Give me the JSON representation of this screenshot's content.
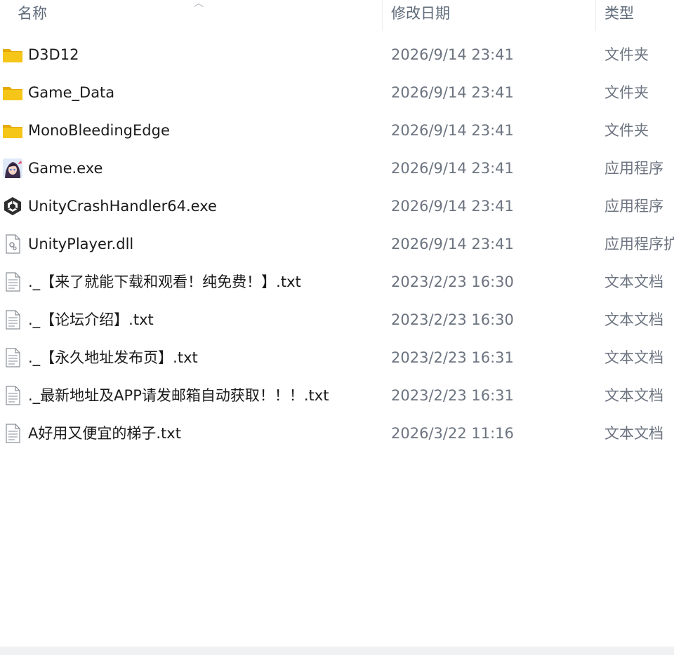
{
  "columns": {
    "name": "名称",
    "modified": "修改日期",
    "type": "类型"
  },
  "files": [
    {
      "name": "D3D12",
      "modified": "2026/9/14 23:41",
      "type": "文件夹",
      "icon": "folder-icon"
    },
    {
      "name": "Game_Data",
      "modified": "2026/9/14 23:41",
      "type": "文件夹",
      "icon": "folder-icon"
    },
    {
      "name": "MonoBleedingEdge",
      "modified": "2026/9/14 23:41",
      "type": "文件夹",
      "icon": "folder-icon"
    },
    {
      "name": "Game.exe",
      "modified": "2026/9/14 23:41",
      "type": "应用程序",
      "icon": "game-app-icon"
    },
    {
      "name": "UnityCrashHandler64.exe",
      "modified": "2026/9/14 23:41",
      "type": "应用程序",
      "icon": "unity-logo-icon"
    },
    {
      "name": "UnityPlayer.dll",
      "modified": "2026/9/14 23:41",
      "type": "应用程序扩",
      "icon": "dll-file-icon"
    },
    {
      "name": "._【来了就能下载和观看！纯免费！】.txt",
      "modified": "2023/2/23 16:30",
      "type": "文本文档",
      "icon": "text-file-icon"
    },
    {
      "name": "._【论坛介绍】.txt",
      "modified": "2023/2/23 16:30",
      "type": "文本文档",
      "icon": "text-file-icon"
    },
    {
      "name": "._【永久地址发布页】.txt",
      "modified": "2023/2/23 16:31",
      "type": "文本文档",
      "icon": "text-file-icon"
    },
    {
      "name": "._最新地址及APP请发邮箱自动获取！！！.txt",
      "modified": "2023/2/23 16:31",
      "type": "文本文档",
      "icon": "text-file-icon"
    },
    {
      "name": "A好用又便宜的梯子.txt",
      "modified": "2026/3/22 11:16",
      "type": "文本文档",
      "icon": "text-file-icon"
    }
  ],
  "colors": {
    "folder": "#f5c518",
    "folder_tab": "#e5a900",
    "header_text": "#5f6b7a",
    "secondary_text": "#6c7480",
    "primary_text": "#1b1b1b"
  }
}
